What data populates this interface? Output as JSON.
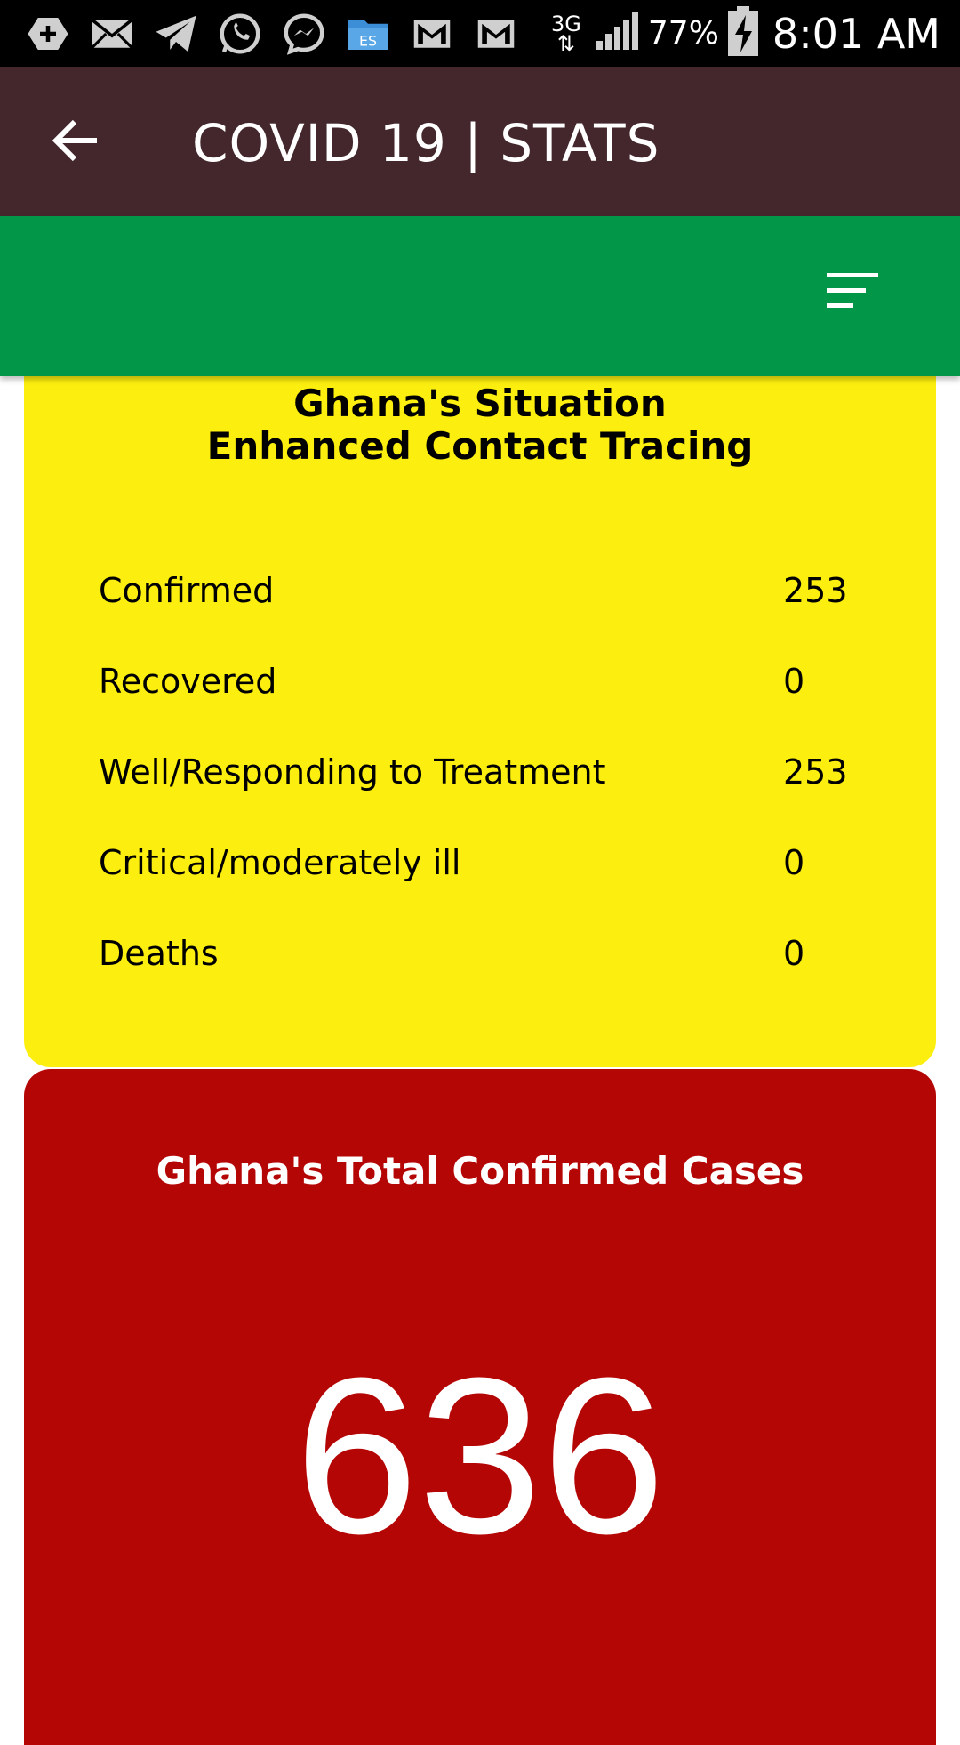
{
  "status_bar": {
    "icons": [
      "plus-box-icon",
      "mail-icon",
      "telegram-icon",
      "whatsapp-icon",
      "messenger-icon",
      "file-explorer-icon",
      "gmail-icon",
      "gmail-icon"
    ],
    "network": "3G",
    "battery_percent": "77%",
    "time": "8:01 AM"
  },
  "app_bar": {
    "title": "COVID 19 | STATS",
    "background": "#43272c"
  },
  "toolbar": {
    "background": "#019648",
    "menu_icon": "sort-menu-icon"
  },
  "situation_card": {
    "heading_line1": "Ghana's Situation",
    "heading_line2": "Enhanced Contact Tracing",
    "background": "#fcef0f",
    "rows": [
      {
        "label": "Confirmed",
        "value": "253"
      },
      {
        "label": "Recovered",
        "value": "0"
      },
      {
        "label": "Well/Responding to Treatment",
        "value": "253"
      },
      {
        "label": "Critical/moderately ill",
        "value": "0"
      },
      {
        "label": "Deaths",
        "value": "0"
      }
    ]
  },
  "total_card": {
    "heading": "Ghana's Total Confirmed Cases",
    "value": "636",
    "background": "#b50606"
  }
}
